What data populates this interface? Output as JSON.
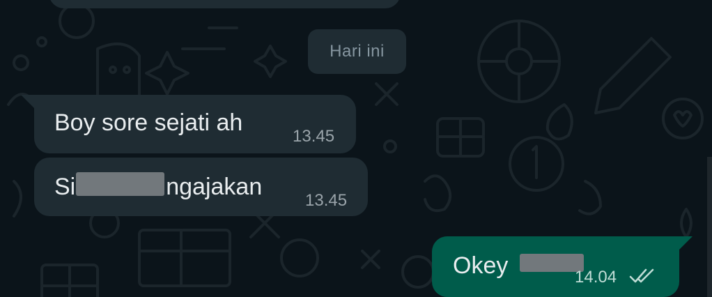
{
  "chat": {
    "date_separator": "Hari ini",
    "messages": [
      {
        "direction": "incoming",
        "text": "Boy sore sejati ah",
        "time": "13.45"
      },
      {
        "direction": "incoming",
        "text_before_redaction": "Si",
        "text_after_redaction": "ngajakan",
        "time": "13.45"
      },
      {
        "direction": "outgoing",
        "text": "Okey",
        "time": "14.04",
        "status_icon": "double-check-icon"
      }
    ]
  },
  "colors": {
    "background": "#0b141a",
    "incoming_bubble": "#1f2c33",
    "outgoing_bubble": "#005c4b",
    "primary_text": "#e9edef",
    "secondary_text": "#8696a0"
  }
}
